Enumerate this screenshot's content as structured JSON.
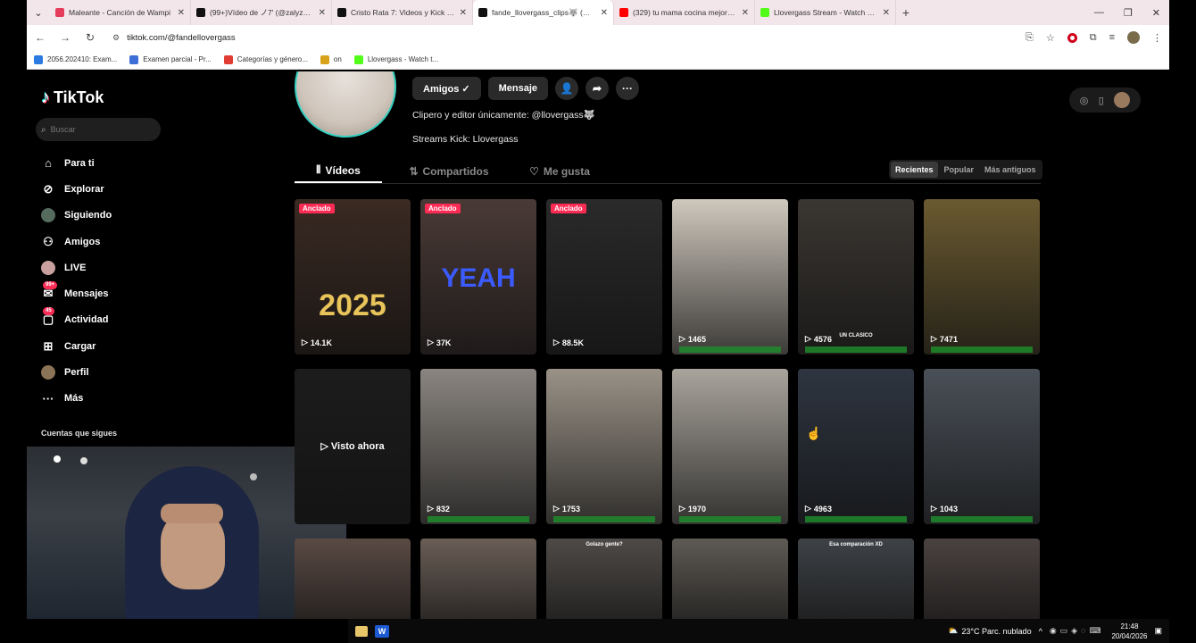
{
  "browser": {
    "tabs": [
      {
        "title": "Maleante - Canción de Wampi",
        "color": "#e43d5c"
      },
      {
        "title": "(99+)Vídeo de ノ7' (@zalyzzz3)",
        "color": "#111111"
      },
      {
        "title": "Cristo Rata 7: Videos y Kick Per",
        "color": "#111111"
      },
      {
        "title": "fande_llovergass_clips🐺 (@fa",
        "color": "#111111"
      },
      {
        "title": "(329) tu mama cocina mejor qu",
        "color": "#ff0000"
      },
      {
        "title": "Llovergass Stream - Watch Live",
        "color": "#53fc18"
      }
    ],
    "url": "tiktok.com/@fandellovergass",
    "bookmarks": [
      {
        "label": "2056.202410: Exam...",
        "color": "#2a7ae2"
      },
      {
        "label": "Examen parcial - Pr...",
        "color": "#3d6fd6"
      },
      {
        "label": "Categorías y género...",
        "color": "#e03c31"
      },
      {
        "label": "on",
        "color": "#d8a31a"
      },
      {
        "label": "Llovergass - Watch t...",
        "color": "#53fc18"
      }
    ]
  },
  "tiktok": {
    "logo": "TikTok",
    "search_placeholder": "Buscar",
    "nav": [
      {
        "label": "Para ti",
        "icon": "home-icon"
      },
      {
        "label": "Explorar",
        "icon": "compass-icon"
      },
      {
        "label": "Siguiendo",
        "icon": "following-avatar-icon"
      },
      {
        "label": "Amigos",
        "icon": "friends-icon"
      },
      {
        "label": "LIVE",
        "icon": "live-icon"
      },
      {
        "label": "Mensajes",
        "icon": "messages-icon",
        "badge": "99+"
      },
      {
        "label": "Actividad",
        "icon": "activity-icon",
        "badge": "45"
      },
      {
        "label": "Cargar",
        "icon": "upload-icon"
      },
      {
        "label": "Perfil",
        "icon": "profile-avatar-icon"
      },
      {
        "label": "Más",
        "icon": "more-icon"
      }
    ],
    "following_section": "Cuentas que sigues"
  },
  "profile": {
    "buttons": {
      "amigos": "Amigos ✓",
      "mensaje": "Mensaje"
    },
    "bio_line1": "Clipero y editor únicamente: @llovergass🐺",
    "bio_line2": "Streams Kick: Llovergass",
    "tabs": [
      "Vídeos",
      "Compartidos",
      "Me gusta"
    ],
    "sort": [
      "Recientes",
      "Popular",
      "Más antiguos"
    ]
  },
  "videos": [
    {
      "views": "14.1K",
      "pinned": "Anclado",
      "bg": "#3a2a22",
      "overlay": "2025",
      "overlay_color": "#e8c45a"
    },
    {
      "views": "37K",
      "pinned": "Anclado",
      "bg": "#4a3a36",
      "overlay": "YEAH",
      "overlay_color": "#3b5bff"
    },
    {
      "views": "88.5K",
      "pinned": "Anclado",
      "bg": "#2a2a2a"
    },
    {
      "views": "1465",
      "bg": "#cfc8bd",
      "kick": true
    },
    {
      "views": "4576",
      "bg": "#3a3632",
      "kick": true,
      "caption": "UN CLASICO"
    },
    {
      "views": "7471",
      "bg": "#6a5a30",
      "kick": true
    },
    {
      "views": "",
      "bg": "#1c1c1c",
      "watched": "▷ Visto ahora"
    },
    {
      "views": "832",
      "bg": "#8a8580",
      "kick": true
    },
    {
      "views": "1753",
      "bg": "#9a9287",
      "kick": true
    },
    {
      "views": "1970",
      "bg": "#a9a49c",
      "kick": true
    },
    {
      "views": "4963",
      "bg": "#2e3540",
      "kick": true
    },
    {
      "views": "1043",
      "bg": "#4a5058",
      "kick": true
    },
    {
      "views": "",
      "bg": "#5a4a44"
    },
    {
      "views": "",
      "bg": "#6a5e56"
    },
    {
      "views": "",
      "bg": "#4e4a47",
      "caption": "Golazo gente?"
    },
    {
      "views": "",
      "bg": "#5e5a54"
    },
    {
      "views": "",
      "bg": "#3e4246",
      "caption": "Esa comparación XD"
    },
    {
      "views": "",
      "bg": "#4a4240"
    }
  ],
  "taskbar": {
    "weather": "23°C  Parc. nublado",
    "time": "21:48",
    "date": "20/04/2026"
  }
}
